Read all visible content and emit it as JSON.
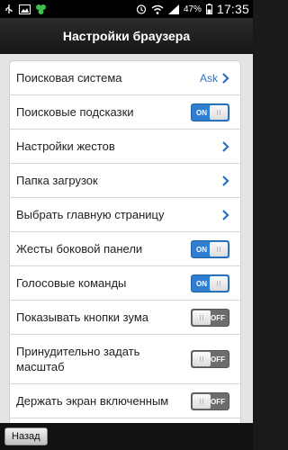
{
  "status_bar": {
    "battery_percent": "47%",
    "time": "17:35",
    "icons": [
      "usb-icon",
      "image-icon",
      "app-icon",
      "alarm-icon",
      "wifi-icon",
      "signal-icon",
      "battery-icon"
    ]
  },
  "header": {
    "title": "Настройки браузера"
  },
  "settings": {
    "items": [
      {
        "label": "Поисковая система",
        "type": "link",
        "value": "Ask"
      },
      {
        "label": "Поисковые подсказки",
        "type": "toggle",
        "state": "ON"
      },
      {
        "label": "Настройки жестов",
        "type": "link"
      },
      {
        "label": "Папка загрузок",
        "type": "link"
      },
      {
        "label": "Выбрать главную страницу",
        "type": "link"
      },
      {
        "label": "Жесты боковой панели",
        "type": "toggle",
        "state": "ON"
      },
      {
        "label": "Голосовые команды",
        "type": "toggle",
        "state": "ON"
      },
      {
        "label": "Показывать кнопки зума",
        "type": "toggle",
        "state": "OFF"
      },
      {
        "label": "Принудительно задать масштаб",
        "type": "toggle",
        "state": "OFF"
      },
      {
        "label": "Держать экран включенным",
        "type": "toggle",
        "state": "OFF"
      }
    ]
  },
  "footer": {
    "back_label": "Назад"
  },
  "colors": {
    "accent": "#2f7ed2",
    "toggle_off": "#6d6d6d",
    "link_value": "#2a6fc4"
  }
}
